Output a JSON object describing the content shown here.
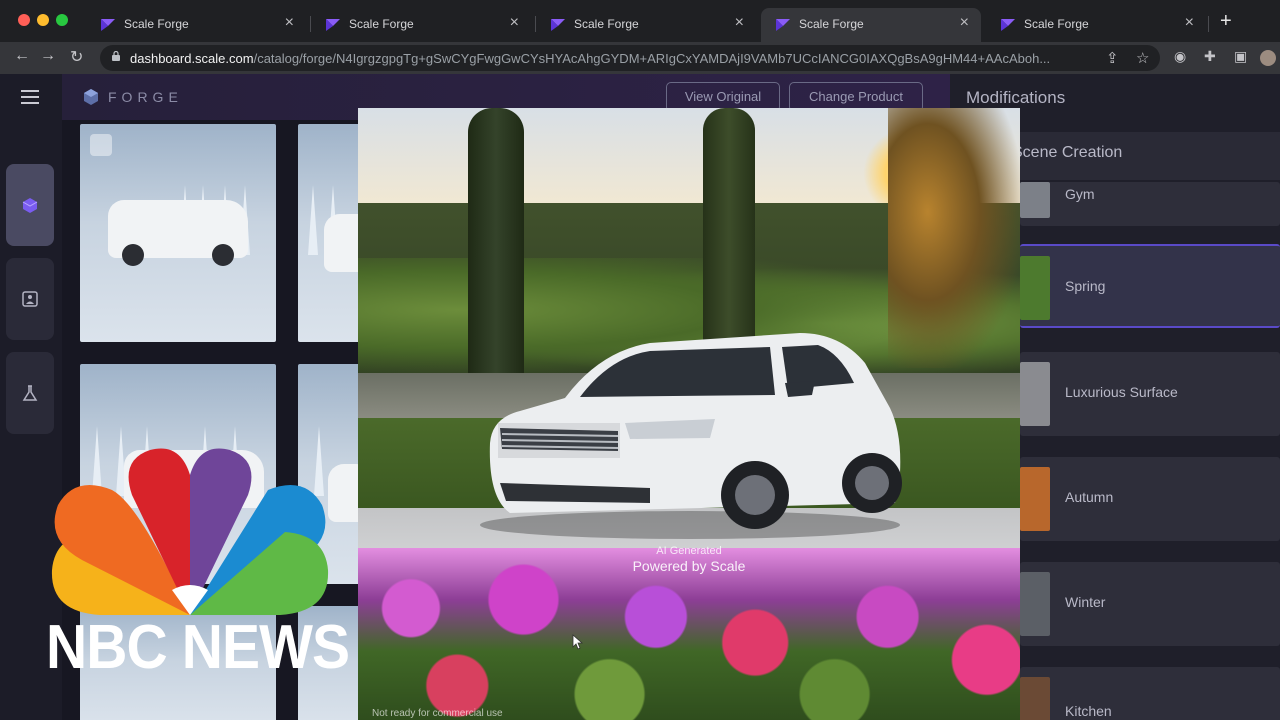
{
  "browser": {
    "tabs": [
      {
        "label": "Scale Forge",
        "active": false
      },
      {
        "label": "Scale Forge",
        "active": false
      },
      {
        "label": "Scale Forge",
        "active": false
      },
      {
        "label": "Scale Forge",
        "active": true
      },
      {
        "label": "Scale Forge",
        "active": false
      }
    ],
    "url_host": "dashboard.scale.com",
    "url_path": "/catalog/forge/N4IgrgzgpgTg+gSwCYgFwgGwCYsHYAcAhgGYDM+ARIgCxYAMDAjI9VAMb7UCcIANCG0IAXQgBsA9gHM44+AAcAboh..."
  },
  "app": {
    "logo_text": "FORGE",
    "view_original_label": "View Original",
    "change_product_label": "Change Product"
  },
  "hero": {
    "watermark_line1": "AI Generated",
    "watermark_line2": "Powered by Scale",
    "disclaimer": "Not ready for commercial use"
  },
  "modifications": {
    "title": "Modifications",
    "section_title": "Scene Creation",
    "scenes": [
      {
        "label": "Gym",
        "thumb_color": "#7c8088"
      },
      {
        "label": "Spring",
        "thumb_color": "#4d7a2e"
      },
      {
        "label": "Luxurious Surface",
        "thumb_color": "#8a8b90"
      },
      {
        "label": "Autumn",
        "thumb_color": "#b8672c"
      },
      {
        "label": "Winter",
        "thumb_color": "#5b5f66"
      },
      {
        "label": "Kitchen",
        "thumb_color": "#6b4a35"
      }
    ],
    "selected": "Spring"
  },
  "overlay": {
    "brand": "NBC NEWS",
    "peacock_colors": [
      "#f6b21a",
      "#ef6a22",
      "#d8232a",
      "#6f4599",
      "#1b8bd1",
      "#5fb946"
    ]
  },
  "icons": {
    "nav": [
      "menu-icon",
      "cube-icon",
      "image-icon",
      "flask-icon"
    ]
  }
}
